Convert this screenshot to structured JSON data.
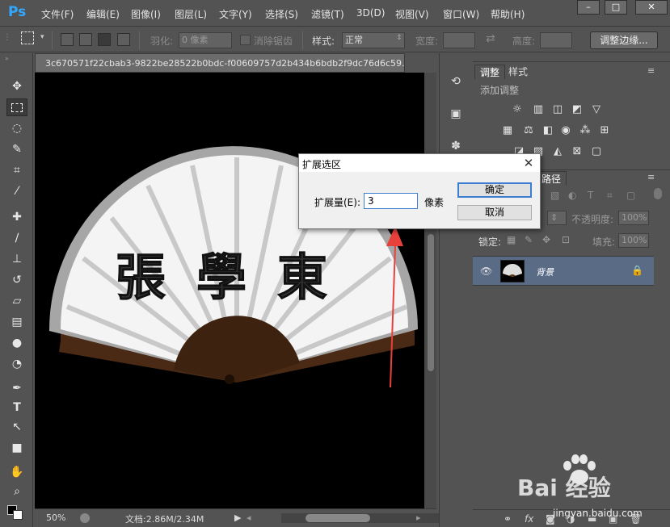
{
  "app": {
    "logo": "Ps",
    "menus": [
      "文件(F)",
      "编辑(E)",
      "图像(I)",
      "图层(L)",
      "文字(Y)",
      "选择(S)",
      "滤镜(T)",
      "3D(D)",
      "视图(V)",
      "窗口(W)",
      "帮助(H)"
    ],
    "window_controls": [
      "–",
      "□",
      "✕"
    ]
  },
  "options": {
    "feather_label": "羽化:",
    "feather_value": "0 像素",
    "antialias_label": "消除锯齿",
    "style_label": "样式:",
    "style_value": "正常",
    "width_label": "宽度:",
    "height_label": "高度:",
    "refine_edge_button": "调整边缘..."
  },
  "document": {
    "tab_title": "3c670571f22cbab3-9822be28522b0bdc-f00609757d2b434b6bdb2f9dc76d6c59.",
    "zoom": "50%",
    "doc_size": "文档:2.86M/2.34M",
    "fan_text": "張學東"
  },
  "adjustments_panel": {
    "tab_adjustments": "调整",
    "tab_styles": "样式",
    "title": "添加调整"
  },
  "layers_panel": {
    "tab_paths": "路径",
    "opacity_label": "不透明度:",
    "opacity_value": "100%",
    "lock_label": "锁定:",
    "fill_label": "填充:",
    "fill_value": "100%",
    "layer_name": "背景"
  },
  "dialog": {
    "title": "扩展选区",
    "expand_label": "扩展量(E):",
    "expand_value": "3",
    "unit": "像素",
    "ok_button": "确定",
    "cancel_button": "取消"
  },
  "watermark": {
    "logo": "Bai  经验",
    "url": "jingyan.baidu.com"
  },
  "colors": {
    "ui_bg": "#535353",
    "canvas_bg": "#000000",
    "arrow": "#e8413c",
    "selected_layer": "#5a6b86",
    "dialog_accent": "#3c7fd1"
  }
}
